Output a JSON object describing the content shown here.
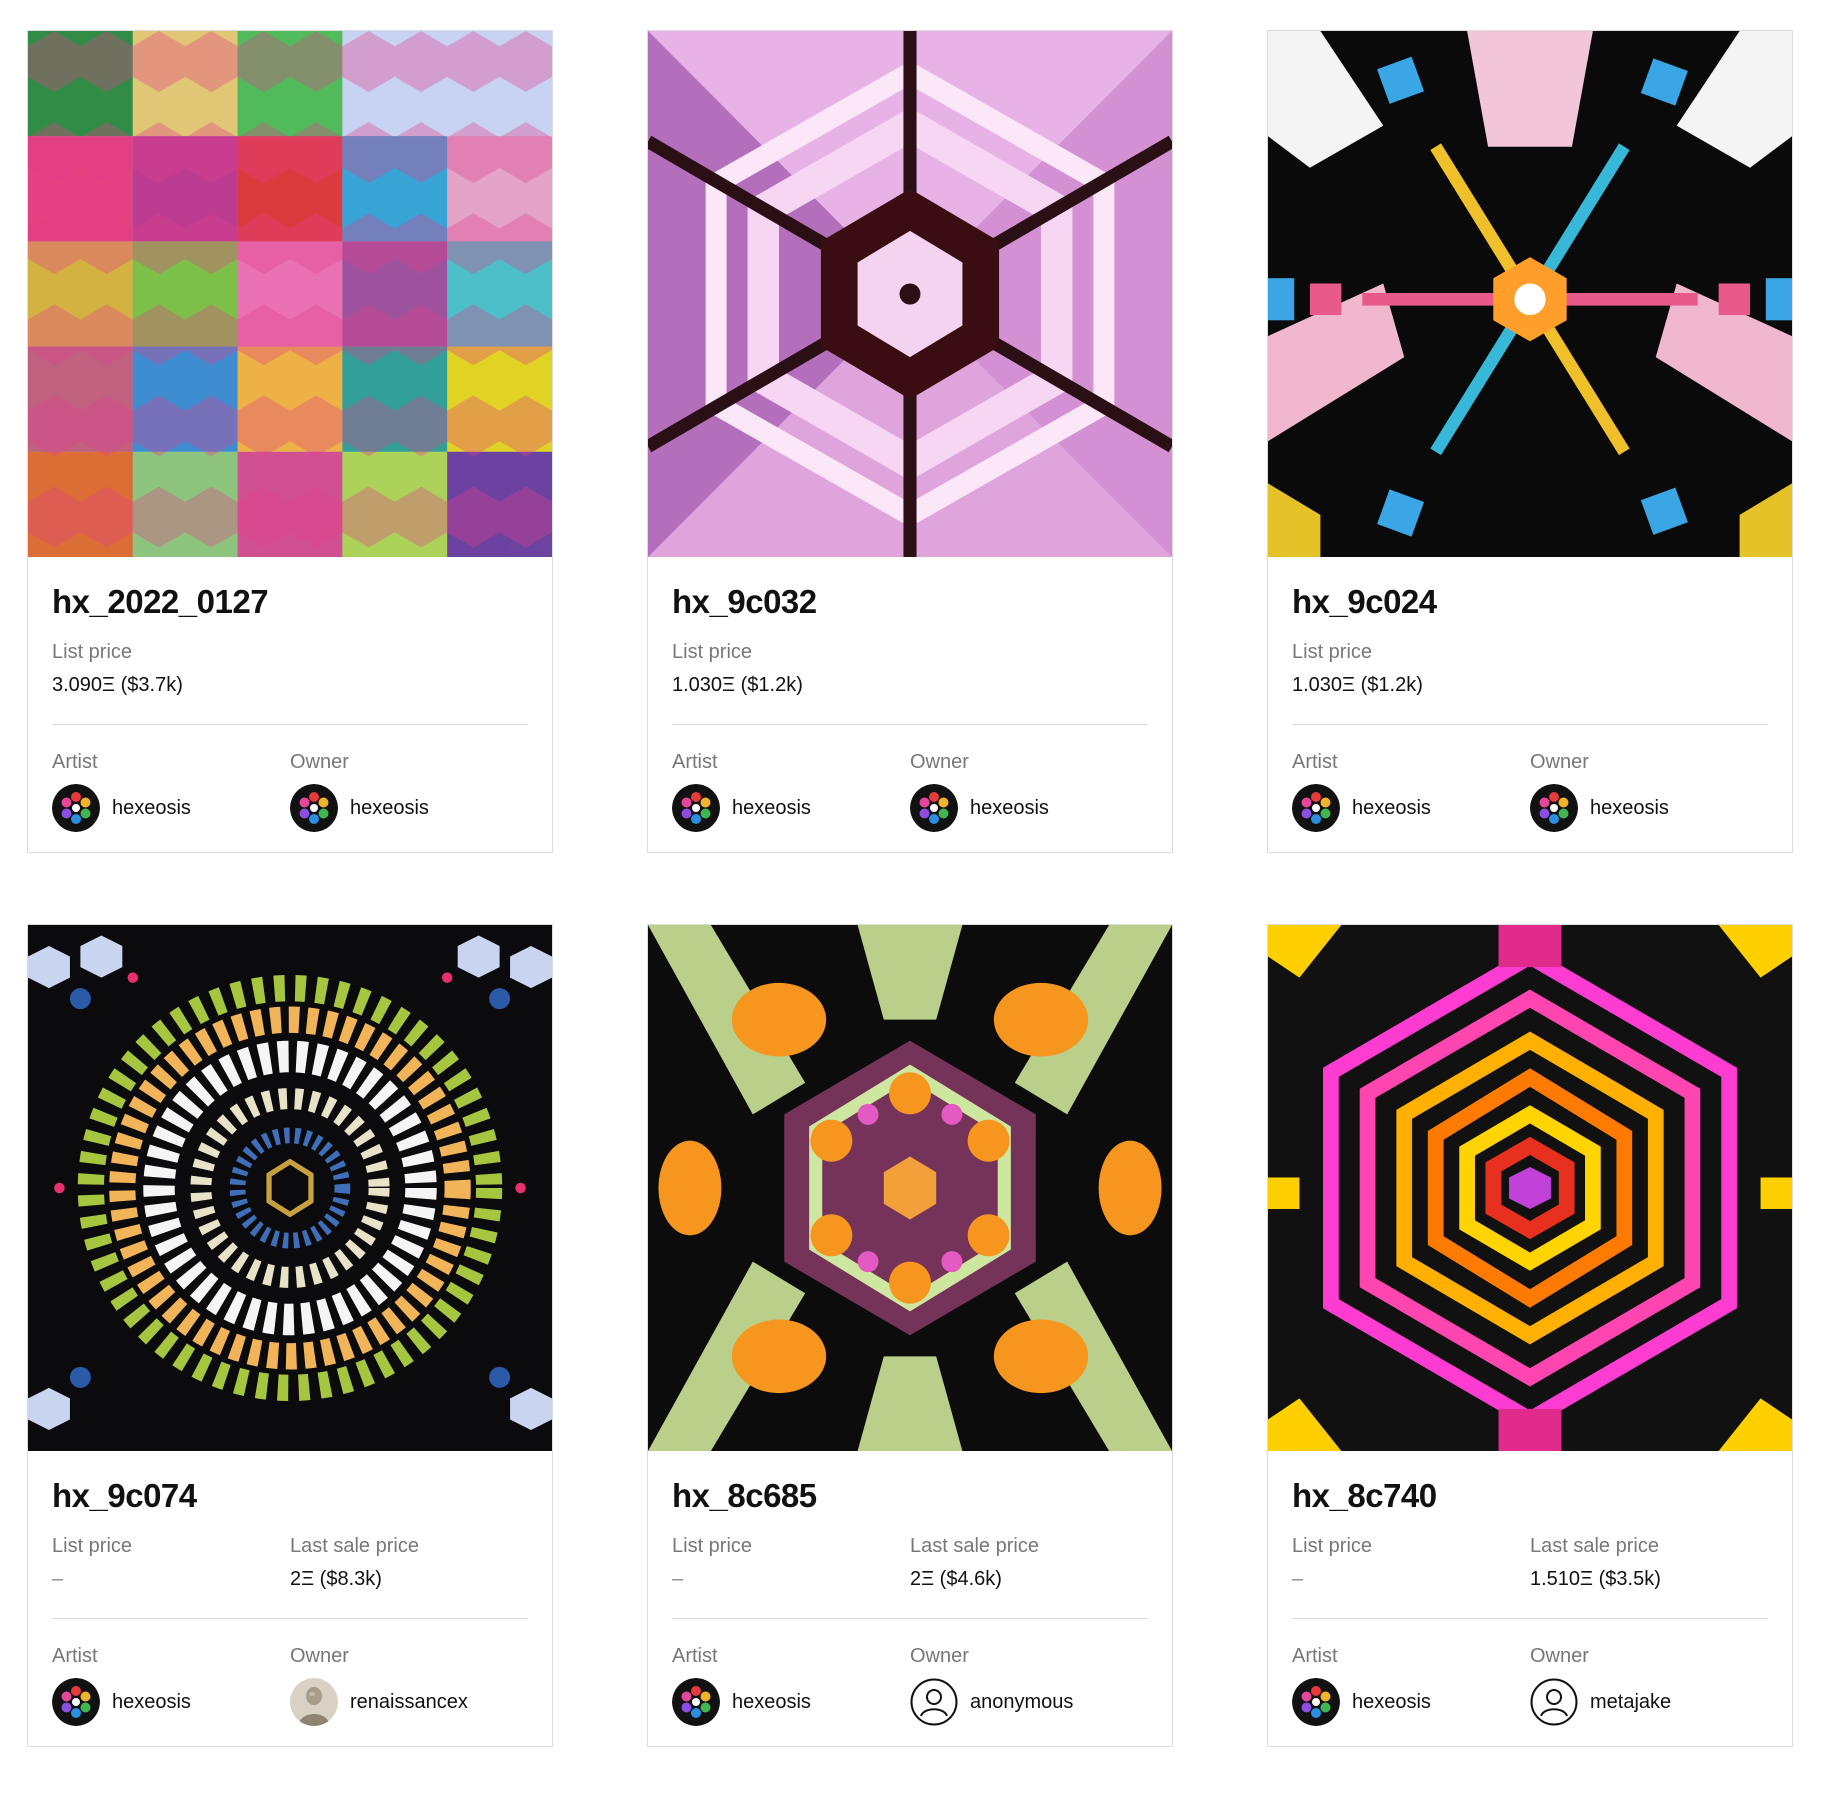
{
  "cards": [
    {
      "title": "hx_2022_0127",
      "price_label": "List price",
      "price_value": "3.090Ξ ($3.7k)",
      "last_sale_label": "",
      "last_sale_value": "",
      "artist_label": "Artist",
      "artist_name": "hexeosis",
      "owner_label": "Owner",
      "owner_name": "hexeosis",
      "owner_avatar": "hexeosis-logo"
    },
    {
      "title": "hx_9c032",
      "price_label": "List price",
      "price_value": "1.030Ξ ($1.2k)",
      "last_sale_label": "",
      "last_sale_value": "",
      "artist_label": "Artist",
      "artist_name": "hexeosis",
      "owner_label": "Owner",
      "owner_name": "hexeosis",
      "owner_avatar": "hexeosis-logo"
    },
    {
      "title": "hx_9c024",
      "price_label": "List price",
      "price_value": "1.030Ξ ($1.2k)",
      "last_sale_label": "",
      "last_sale_value": "",
      "artist_label": "Artist",
      "artist_name": "hexeosis",
      "owner_label": "Owner",
      "owner_name": "hexeosis",
      "owner_avatar": "hexeosis-logo"
    },
    {
      "title": "hx_9c074",
      "price_label": "List price",
      "price_value": "–",
      "last_sale_label": "Last sale price",
      "last_sale_value": "2Ξ ($8.3k)",
      "artist_label": "Artist",
      "artist_name": "hexeosis",
      "owner_label": "Owner",
      "owner_name": "renaissancex",
      "owner_avatar": "statue-photo"
    },
    {
      "title": "hx_8c685",
      "price_label": "List price",
      "price_value": "–",
      "last_sale_label": "Last sale price",
      "last_sale_value": "2Ξ ($4.6k)",
      "artist_label": "Artist",
      "artist_name": "hexeosis",
      "owner_label": "Owner",
      "owner_name": "anonymous",
      "owner_avatar": "user-outline-icon"
    },
    {
      "title": "hx_8c740",
      "price_label": "List price",
      "price_value": "–",
      "last_sale_label": "Last sale price",
      "last_sale_value": "1.510Ξ ($3.5k)",
      "artist_label": "Artist",
      "artist_name": "hexeosis",
      "owner_label": "Owner",
      "owner_name": "metajake",
      "owner_avatar": "user-outline-icon"
    }
  ],
  "colors": {
    "card_border": "#dcdcdc",
    "label_gray": "#777777",
    "text": "#111111"
  }
}
